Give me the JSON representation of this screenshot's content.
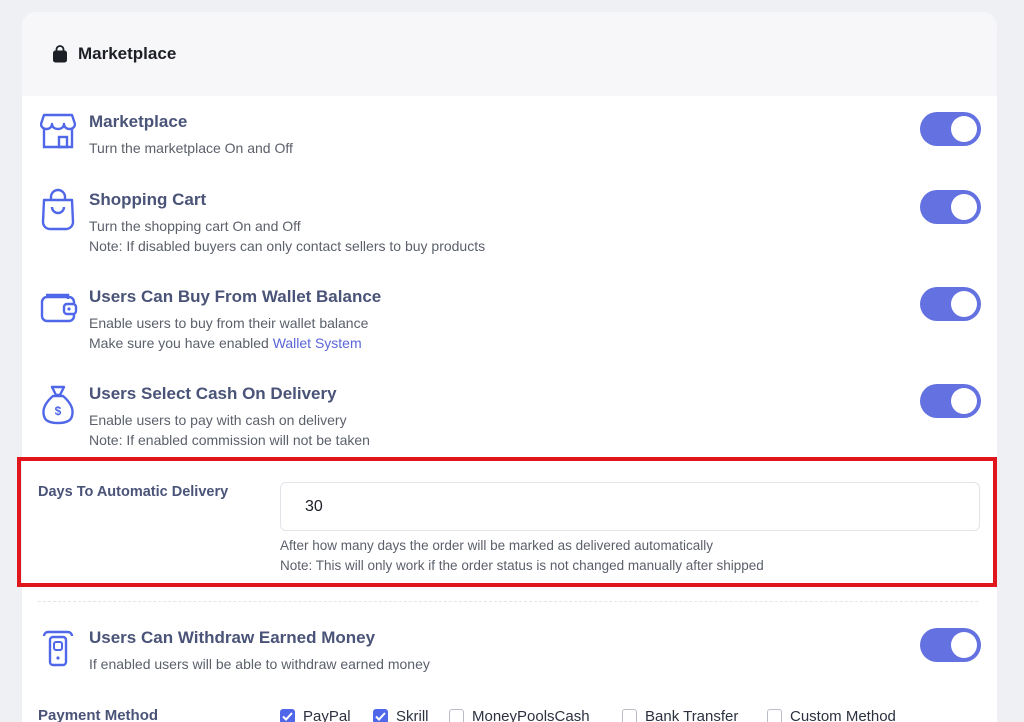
{
  "header": {
    "title": "Marketplace",
    "icon": "shopping-bag-icon"
  },
  "settings": [
    {
      "title": "Marketplace",
      "desc1": "Turn the marketplace On and Off",
      "icon": "storefront-icon",
      "enabled": true
    },
    {
      "title": "Shopping Cart",
      "desc1": "Turn the shopping cart On and Off",
      "desc2": "Note: If disabled buyers can only contact sellers to buy products",
      "icon": "shopping-bag-outline-icon",
      "enabled": true
    },
    {
      "title": "Users Can Buy From Wallet Balance",
      "desc1": "Enable users to buy from their wallet balance",
      "desc2_prefix": "Make sure you have enabled ",
      "desc2_link": "Wallet System",
      "icon": "wallet-icon",
      "enabled": true
    },
    {
      "title": "Users Select Cash On Delivery",
      "desc1": "Enable users to pay with cash on delivery",
      "desc2": "Note: If enabled commission will not be taken",
      "icon": "money-bag-icon",
      "enabled": true
    }
  ],
  "days": {
    "label": "Days To Automatic Delivery",
    "value": "30",
    "help1": "After how many days the order will be marked as delivered automatically",
    "help2": "Note: This will only work if the order status is not changed manually after shipped"
  },
  "withdraw": {
    "title": "Users Can Withdraw Earned Money",
    "desc1": "If enabled users will be able to withdraw earned money",
    "icon": "phone-cash-icon",
    "enabled": true
  },
  "payment": {
    "label": "Payment Method",
    "methods": [
      {
        "label": "PayPal",
        "checked": true
      },
      {
        "label": "Skrill",
        "checked": true
      },
      {
        "label": "MoneyPoolsCash",
        "checked": false
      },
      {
        "label": "Bank Transfer",
        "checked": false
      },
      {
        "label": "Custom Method",
        "checked": false
      }
    ]
  },
  "colors": {
    "accent": "#6471e0",
    "highlight": "#e0161c",
    "title": "#4a5378",
    "link": "#5965d8"
  }
}
